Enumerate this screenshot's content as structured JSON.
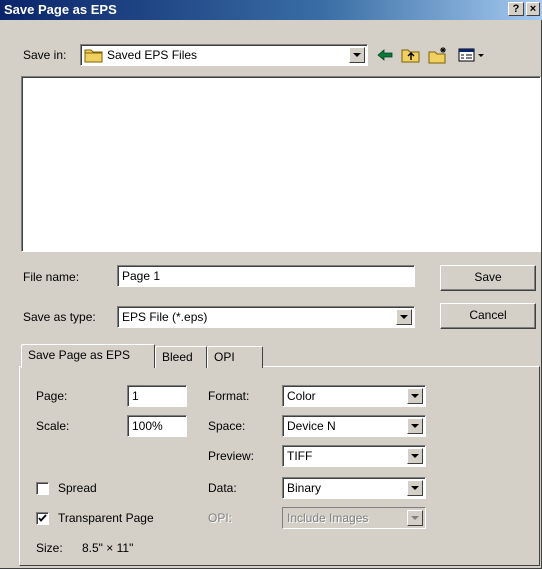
{
  "window": {
    "title": "Save Page as EPS",
    "help_label": "?",
    "close_label": "×"
  },
  "save_in": {
    "label": "Save in:",
    "value": "Saved EPS Files"
  },
  "toolbar": {
    "icons": [
      "back-arrow-icon",
      "up-one-level-icon",
      "new-folder-icon",
      "view-menu-icon"
    ]
  },
  "file_name": {
    "label": "File name:",
    "value": "Page 1"
  },
  "save_as_type": {
    "label": "Save as type:",
    "value": "EPS File (*.eps)"
  },
  "buttons": {
    "save": "Save",
    "cancel": "Cancel"
  },
  "tabs": [
    {
      "label": "Save Page as EPS",
      "active": true
    },
    {
      "label": "Bleed",
      "active": false
    },
    {
      "label": "OPI",
      "active": false
    }
  ],
  "options": {
    "page_label": "Page:",
    "page_value": "1",
    "scale_label": "Scale:",
    "scale_value": "100%",
    "format_label": "Format:",
    "format_value": "Color",
    "space_label": "Space:",
    "space_value": "Device N",
    "preview_label": "Preview:",
    "preview_value": "TIFF",
    "data_label": "Data:",
    "data_value": "Binary",
    "opi_label": "OPI:",
    "opi_value": "Include Images",
    "spread_label": "Spread",
    "spread_checked": false,
    "transparent_label": "Transparent Page",
    "transparent_checked": true,
    "size_label": "Size:",
    "size_value": "8.5\" × 11\""
  },
  "colors": {
    "title_bar": "#0a246a",
    "dialog_face": "#d4d0c8",
    "folder_yellow": "#f0d060",
    "toolbar_arrow": "#0a7a3a"
  }
}
